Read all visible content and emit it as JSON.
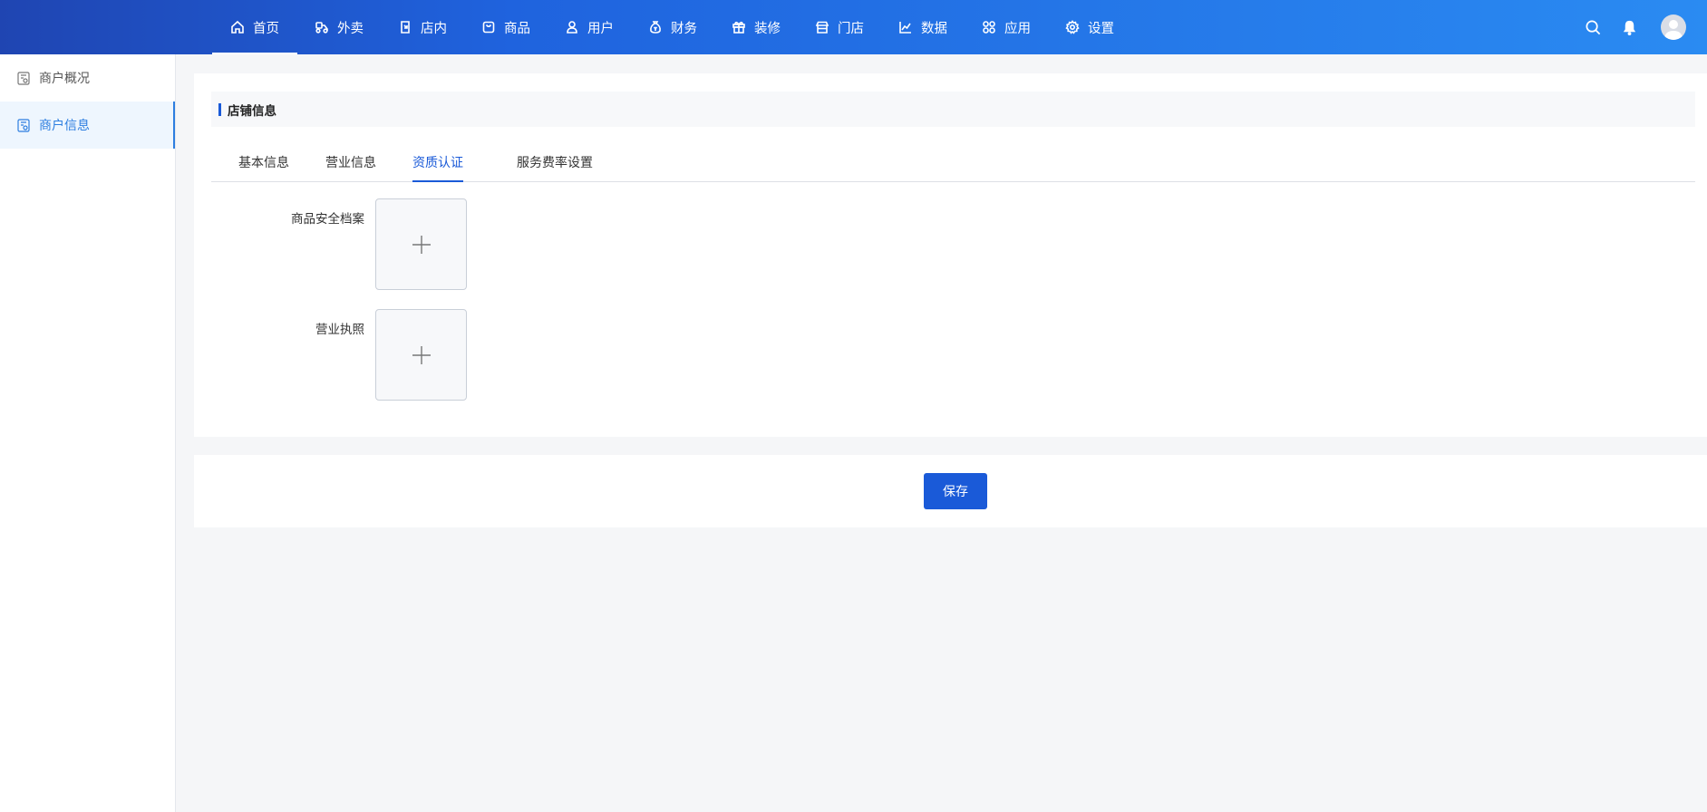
{
  "nav": {
    "items": [
      {
        "label": "首页",
        "icon": "home-icon"
      },
      {
        "label": "外卖",
        "icon": "delivery-icon"
      },
      {
        "label": "店内",
        "icon": "dine-in-icon"
      },
      {
        "label": "商品",
        "icon": "product-icon"
      },
      {
        "label": "用户",
        "icon": "user-icon"
      },
      {
        "label": "财务",
        "icon": "finance-icon"
      },
      {
        "label": "装修",
        "icon": "decorate-icon"
      },
      {
        "label": "门店",
        "icon": "store-icon"
      },
      {
        "label": "数据",
        "icon": "data-chart-icon"
      },
      {
        "label": "应用",
        "icon": "apps-icon"
      },
      {
        "label": "设置",
        "icon": "settings-icon"
      }
    ],
    "active_index": 0
  },
  "sidebar": {
    "items": [
      {
        "label": "商户概况"
      },
      {
        "label": "商户信息"
      }
    ],
    "active_index": 1
  },
  "section": {
    "title": "店铺信息"
  },
  "tabs": {
    "items": [
      {
        "label": "基本信息"
      },
      {
        "label": "营业信息"
      },
      {
        "label": "资质认证"
      },
      {
        "label": "服务费率设置"
      }
    ],
    "active_index": 2
  },
  "form": {
    "fields": [
      {
        "label": "商品安全档案"
      },
      {
        "label": "营业执照"
      }
    ]
  },
  "footer": {
    "save_label": "保存"
  },
  "colors": {
    "primary": "#1a5ad8",
    "nav_gradient_start": "#1f45b2",
    "nav_gradient_end": "#2a8bf2",
    "sidebar_active": "#2d7ee0"
  }
}
